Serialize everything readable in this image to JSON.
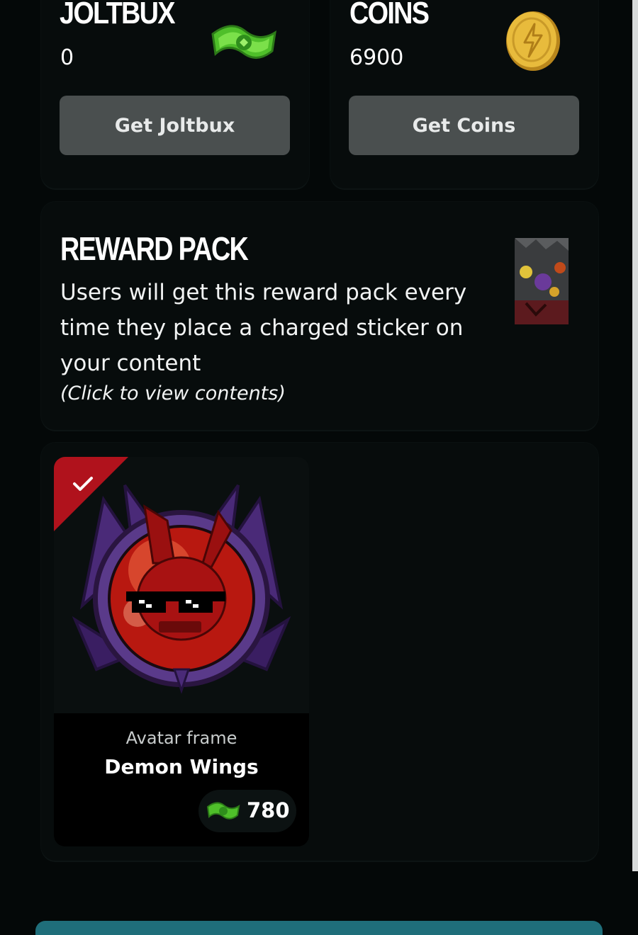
{
  "currencies": [
    {
      "title": "JOLTBUX",
      "value": "0",
      "button_label": "Get Joltbux",
      "icon": "joltbux-bill-icon"
    },
    {
      "title": "COINS",
      "value": "6900",
      "button_label": "Get Coins",
      "icon": "gold-coin-icon"
    }
  ],
  "reward_pack": {
    "title": "REWARD PACK",
    "description": "Users will get this reward pack every time they place a charged sticker on your content",
    "hint": "(Click to view contents)"
  },
  "items": [
    {
      "type": "Avatar frame",
      "name": "Demon Wings",
      "price": "780",
      "price_icon": "joltbux-bill-icon",
      "selected": true
    }
  ],
  "colors": {
    "background": "#040808",
    "card": "#070c0c",
    "button": "#4a4f4f",
    "selected_ribbon": "#b0121c",
    "joltbux_green": "#5bd12a",
    "coin_gold": "#e2b43a"
  }
}
